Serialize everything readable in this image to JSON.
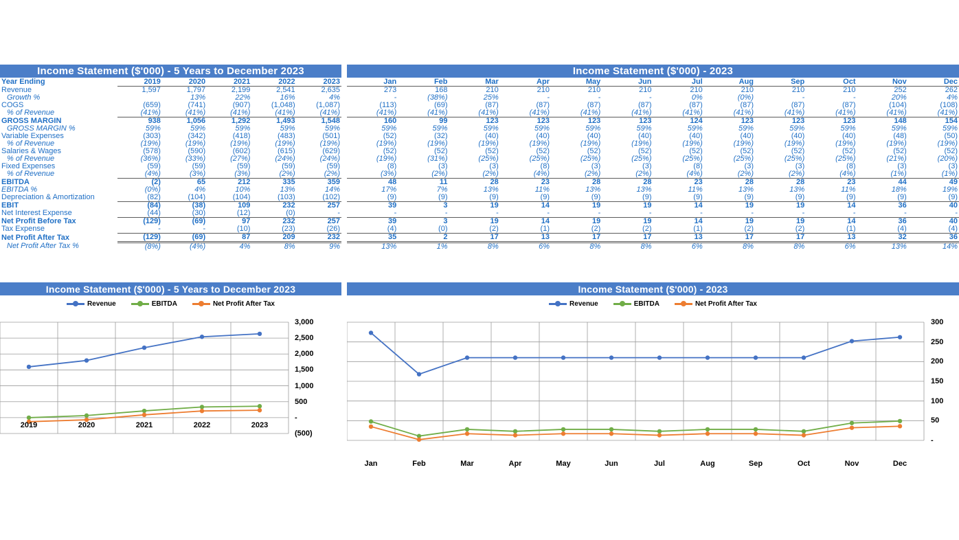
{
  "colors": {
    "header_blue": "#4B7EC8",
    "text_blue": "#1F6FC5",
    "revenue": "#4472C4",
    "ebitda": "#70AD47",
    "npat": "#ED7D31",
    "rule": "#5B5B5B"
  },
  "annual_table": {
    "title": "Income Statement ($'000) - 5 Years to December 2023",
    "row_header_label": "Year Ending",
    "columns": [
      "2019",
      "2020",
      "2021",
      "2022",
      "2023"
    ],
    "rows": [
      {
        "label": "Revenue",
        "style": "plain",
        "values": [
          "1,597",
          "1,797",
          "2,199",
          "2,541",
          "2,635"
        ]
      },
      {
        "label": "Growth %",
        "style": "italic-ind",
        "values": [
          "",
          "13%",
          "22%",
          "16%",
          "4%"
        ]
      },
      {
        "label": "COGS",
        "style": "plain",
        "values": [
          "(659)",
          "(741)",
          "(907)",
          "(1,048)",
          "(1,087)"
        ]
      },
      {
        "label": "% of Revenue",
        "style": "italic-ind",
        "values": [
          "(41%)",
          "(41%)",
          "(41%)",
          "(41%)",
          "(41%)"
        ],
        "rule": "bottom"
      },
      {
        "label": "GROSS MARGIN",
        "style": "bold",
        "values": [
          "938",
          "1,056",
          "1,292",
          "1,493",
          "1,548"
        ]
      },
      {
        "label": "GROSS MARGIN %",
        "style": "italic-ind",
        "values": [
          "59%",
          "59%",
          "59%",
          "59%",
          "59%"
        ]
      },
      {
        "label": "Variable Expenses",
        "style": "plain",
        "values": [
          "(303)",
          "(342)",
          "(418)",
          "(483)",
          "(501)"
        ]
      },
      {
        "label": "% of Revenue",
        "style": "italic-ind",
        "values": [
          "(19%)",
          "(19%)",
          "(19%)",
          "(19%)",
          "(19%)"
        ]
      },
      {
        "label": "Salaries & Wages",
        "style": "plain",
        "values": [
          "(578)",
          "(590)",
          "(602)",
          "(615)",
          "(629)"
        ]
      },
      {
        "label": "% of Revenue",
        "style": "italic-ind",
        "values": [
          "(36%)",
          "(33%)",
          "(27%)",
          "(24%)",
          "(24%)"
        ]
      },
      {
        "label": "Fixed Expenses",
        "style": "plain",
        "values": [
          "(59)",
          "(59)",
          "(59)",
          "(59)",
          "(59)"
        ]
      },
      {
        "label": "% of Revenue",
        "style": "italic-ind",
        "values": [
          "(4%)",
          "(3%)",
          "(3%)",
          "(2%)",
          "(2%)"
        ],
        "rule": "bottom"
      },
      {
        "label": "EBITDA",
        "style": "bold",
        "values": [
          "(2)",
          "65",
          "212",
          "335",
          "359"
        ]
      },
      {
        "label": "EBITDA %",
        "style": "italic",
        "values": [
          "(0%)",
          "4%",
          "10%",
          "13%",
          "14%"
        ]
      },
      {
        "label": "Depreciation & Amortization",
        "style": "plain",
        "values": [
          "(82)",
          "(104)",
          "(104)",
          "(103)",
          "(102)"
        ],
        "rule": "bottom"
      },
      {
        "label": "EBIT",
        "style": "bold",
        "values": [
          "(84)",
          "(38)",
          "109",
          "232",
          "257"
        ]
      },
      {
        "label": "Net Interest Expense",
        "style": "plain",
        "values": [
          "(44)",
          "(30)",
          "(12)",
          "(0)",
          "-"
        ],
        "rule": "bottom"
      },
      {
        "label": "Net Profit Before Tax",
        "style": "bold",
        "values": [
          "(129)",
          "(69)",
          "97",
          "232",
          "257"
        ]
      },
      {
        "label": "Tax Expense",
        "style": "plain",
        "values": [
          "-",
          "-",
          "(10)",
          "(23)",
          "(26)"
        ],
        "rule": "bottom"
      },
      {
        "label": "Net Profit After Tax",
        "style": "bold",
        "values": [
          "(129)",
          "(69)",
          "87",
          "209",
          "232"
        ],
        "rule": "double"
      },
      {
        "label": "Net Profit After Tax %",
        "style": "italic-ind",
        "values": [
          "(8%)",
          "(4%)",
          "4%",
          "8%",
          "9%"
        ]
      }
    ]
  },
  "monthly_table": {
    "title": "Income Statement ($'000) - 2023",
    "columns": [
      "Jan",
      "Feb",
      "Mar",
      "Apr",
      "May",
      "Jun",
      "Jul",
      "Aug",
      "Sep",
      "Oct",
      "Nov",
      "Dec"
    ],
    "rows": [
      {
        "label": "Revenue",
        "style": "plain",
        "values": [
          "273",
          "168",
          "210",
          "210",
          "210",
          "210",
          "210",
          "210",
          "210",
          "210",
          "252",
          "262"
        ]
      },
      {
        "label": "Growth %",
        "style": "italic-ind",
        "values": [
          "-",
          "(38%)",
          "25%",
          "-",
          "-",
          "-",
          "0%",
          "(0%)",
          "-",
          "-",
          "20%",
          "4%"
        ]
      },
      {
        "label": "COGS",
        "style": "plain",
        "values": [
          "(113)",
          "(69)",
          "(87)",
          "(87)",
          "(87)",
          "(87)",
          "(87)",
          "(87)",
          "(87)",
          "(87)",
          "(104)",
          "(108)"
        ]
      },
      {
        "label": "% of Revenue",
        "style": "italic-ind",
        "values": [
          "(41%)",
          "(41%)",
          "(41%)",
          "(41%)",
          "(41%)",
          "(41%)",
          "(41%)",
          "(41%)",
          "(41%)",
          "(41%)",
          "(41%)",
          "(41%)"
        ],
        "rule": "bottom"
      },
      {
        "label": "GROSS MARGIN",
        "style": "bold",
        "values": [
          "160",
          "99",
          "123",
          "123",
          "123",
          "123",
          "124",
          "123",
          "123",
          "123",
          "148",
          "154"
        ]
      },
      {
        "label": "GROSS MARGIN %",
        "style": "italic-ind",
        "values": [
          "59%",
          "59%",
          "59%",
          "59%",
          "59%",
          "59%",
          "59%",
          "59%",
          "59%",
          "59%",
          "59%",
          "59%"
        ]
      },
      {
        "label": "Variable Expenses",
        "style": "plain",
        "values": [
          "(52)",
          "(32)",
          "(40)",
          "(40)",
          "(40)",
          "(40)",
          "(40)",
          "(40)",
          "(40)",
          "(40)",
          "(48)",
          "(50)"
        ]
      },
      {
        "label": "% of Revenue",
        "style": "italic-ind",
        "values": [
          "(19%)",
          "(19%)",
          "(19%)",
          "(19%)",
          "(19%)",
          "(19%)",
          "(19%)",
          "(19%)",
          "(19%)",
          "(19%)",
          "(19%)",
          "(19%)"
        ]
      },
      {
        "label": "Salaries & Wages",
        "style": "plain",
        "values": [
          "(52)",
          "(52)",
          "(52)",
          "(52)",
          "(52)",
          "(52)",
          "(52)",
          "(52)",
          "(52)",
          "(52)",
          "(52)",
          "(52)"
        ]
      },
      {
        "label": "% of Revenue",
        "style": "italic-ind",
        "values": [
          "(19%)",
          "(31%)",
          "(25%)",
          "(25%)",
          "(25%)",
          "(25%)",
          "(25%)",
          "(25%)",
          "(25%)",
          "(25%)",
          "(21%)",
          "(20%)"
        ]
      },
      {
        "label": "Fixed Expenses",
        "style": "plain",
        "values": [
          "(8)",
          "(3)",
          "(3)",
          "(8)",
          "(3)",
          "(3)",
          "(8)",
          "(3)",
          "(3)",
          "(8)",
          "(3)",
          "(3)"
        ]
      },
      {
        "label": "% of Revenue",
        "style": "italic-ind",
        "values": [
          "(3%)",
          "(2%)",
          "(2%)",
          "(4%)",
          "(2%)",
          "(2%)",
          "(4%)",
          "(2%)",
          "(2%)",
          "(4%)",
          "(1%)",
          "(1%)"
        ],
        "rule": "bottom"
      },
      {
        "label": "EBITDA",
        "style": "bold",
        "values": [
          "48",
          "11",
          "28",
          "23",
          "28",
          "28",
          "23",
          "28",
          "28",
          "23",
          "44",
          "49"
        ]
      },
      {
        "label": "EBITDA %",
        "style": "italic",
        "values": [
          "17%",
          "7%",
          "13%",
          "11%",
          "13%",
          "13%",
          "11%",
          "13%",
          "13%",
          "11%",
          "18%",
          "19%"
        ]
      },
      {
        "label": "Depreciation & Amortization",
        "style": "plain",
        "values": [
          "(9)",
          "(9)",
          "(9)",
          "(9)",
          "(9)",
          "(9)",
          "(9)",
          "(9)",
          "(9)",
          "(9)",
          "(9)",
          "(9)"
        ],
        "rule": "bottom"
      },
      {
        "label": "EBIT",
        "style": "bold",
        "values": [
          "39",
          "3",
          "19",
          "14",
          "19",
          "19",
          "14",
          "19",
          "19",
          "14",
          "36",
          "40"
        ]
      },
      {
        "label": "Net Interest Expense",
        "style": "plain",
        "values": [
          "-",
          "-",
          "-",
          "-",
          "-",
          "-",
          "-",
          "-",
          "-",
          "-",
          "-",
          "-"
        ],
        "rule": "bottom"
      },
      {
        "label": "Net Profit Before Tax",
        "style": "bold",
        "values": [
          "39",
          "3",
          "19",
          "14",
          "19",
          "19",
          "14",
          "19",
          "19",
          "14",
          "36",
          "40"
        ]
      },
      {
        "label": "Tax Expense",
        "style": "plain",
        "values": [
          "(4)",
          "(0)",
          "(2)",
          "(1)",
          "(2)",
          "(2)",
          "(1)",
          "(2)",
          "(2)",
          "(1)",
          "(4)",
          "(4)"
        ],
        "rule": "bottom"
      },
      {
        "label": "Net Profit After Tax",
        "style": "bold",
        "values": [
          "35",
          "2",
          "17",
          "13",
          "17",
          "17",
          "13",
          "17",
          "17",
          "13",
          "32",
          "36"
        ],
        "rule": "double"
      },
      {
        "label": "Net Profit After Tax %",
        "style": "italic-ind",
        "values": [
          "13%",
          "1%",
          "8%",
          "6%",
          "8%",
          "8%",
          "6%",
          "8%",
          "8%",
          "6%",
          "13%",
          "14%"
        ]
      }
    ]
  },
  "chart_data": [
    {
      "id": "annual-chart",
      "type": "line",
      "title": "Income Statement ($'000) - 5 Years to December 2023",
      "xlabel": "",
      "ylabel": "",
      "grid": true,
      "legend_position": "top",
      "categories": [
        "2019",
        "2020",
        "2021",
        "2022",
        "2023"
      ],
      "ylim": [
        -500,
        3000
      ],
      "ytick_labels": [
        "3,000",
        "2,500",
        "2,000",
        "1,500",
        "1,000",
        "500",
        "-",
        "(500)"
      ],
      "ytick_values": [
        3000,
        2500,
        2000,
        1500,
        1000,
        500,
        0,
        -500
      ],
      "series": [
        {
          "name": "Revenue",
          "color": "#4472C4",
          "values": [
            1597,
            1797,
            2199,
            2541,
            2635
          ]
        },
        {
          "name": "EBITDA",
          "color": "#70AD47",
          "values": [
            -2,
            65,
            212,
            335,
            359
          ]
        },
        {
          "name": "Net Profit After Tax",
          "color": "#ED7D31",
          "values": [
            -129,
            -69,
            87,
            209,
            232
          ]
        }
      ]
    },
    {
      "id": "monthly-chart",
      "type": "line",
      "title": "Income Statement ($'000) - 2023",
      "xlabel": "",
      "ylabel": "",
      "grid": true,
      "legend_position": "top",
      "categories": [
        "Jan",
        "Feb",
        "Mar",
        "Apr",
        "May",
        "Jun",
        "Jul",
        "Aug",
        "Sep",
        "Oct",
        "Nov",
        "Dec"
      ],
      "ylim": [
        0,
        300
      ],
      "ytick_labels": [
        "300",
        "250",
        "200",
        "150",
        "100",
        "50",
        "-"
      ],
      "ytick_values": [
        300,
        250,
        200,
        150,
        100,
        50,
        0
      ],
      "series": [
        {
          "name": "Revenue",
          "color": "#4472C4",
          "values": [
            273,
            168,
            210,
            210,
            210,
            210,
            210,
            210,
            210,
            210,
            252,
            262
          ]
        },
        {
          "name": "EBITDA",
          "color": "#70AD47",
          "values": [
            48,
            11,
            28,
            23,
            28,
            28,
            23,
            28,
            28,
            23,
            44,
            49
          ]
        },
        {
          "name": "Net Profit After Tax",
          "color": "#ED7D31",
          "values": [
            35,
            2,
            17,
            13,
            17,
            17,
            13,
            17,
            17,
            13,
            32,
            36
          ]
        }
      ]
    }
  ]
}
